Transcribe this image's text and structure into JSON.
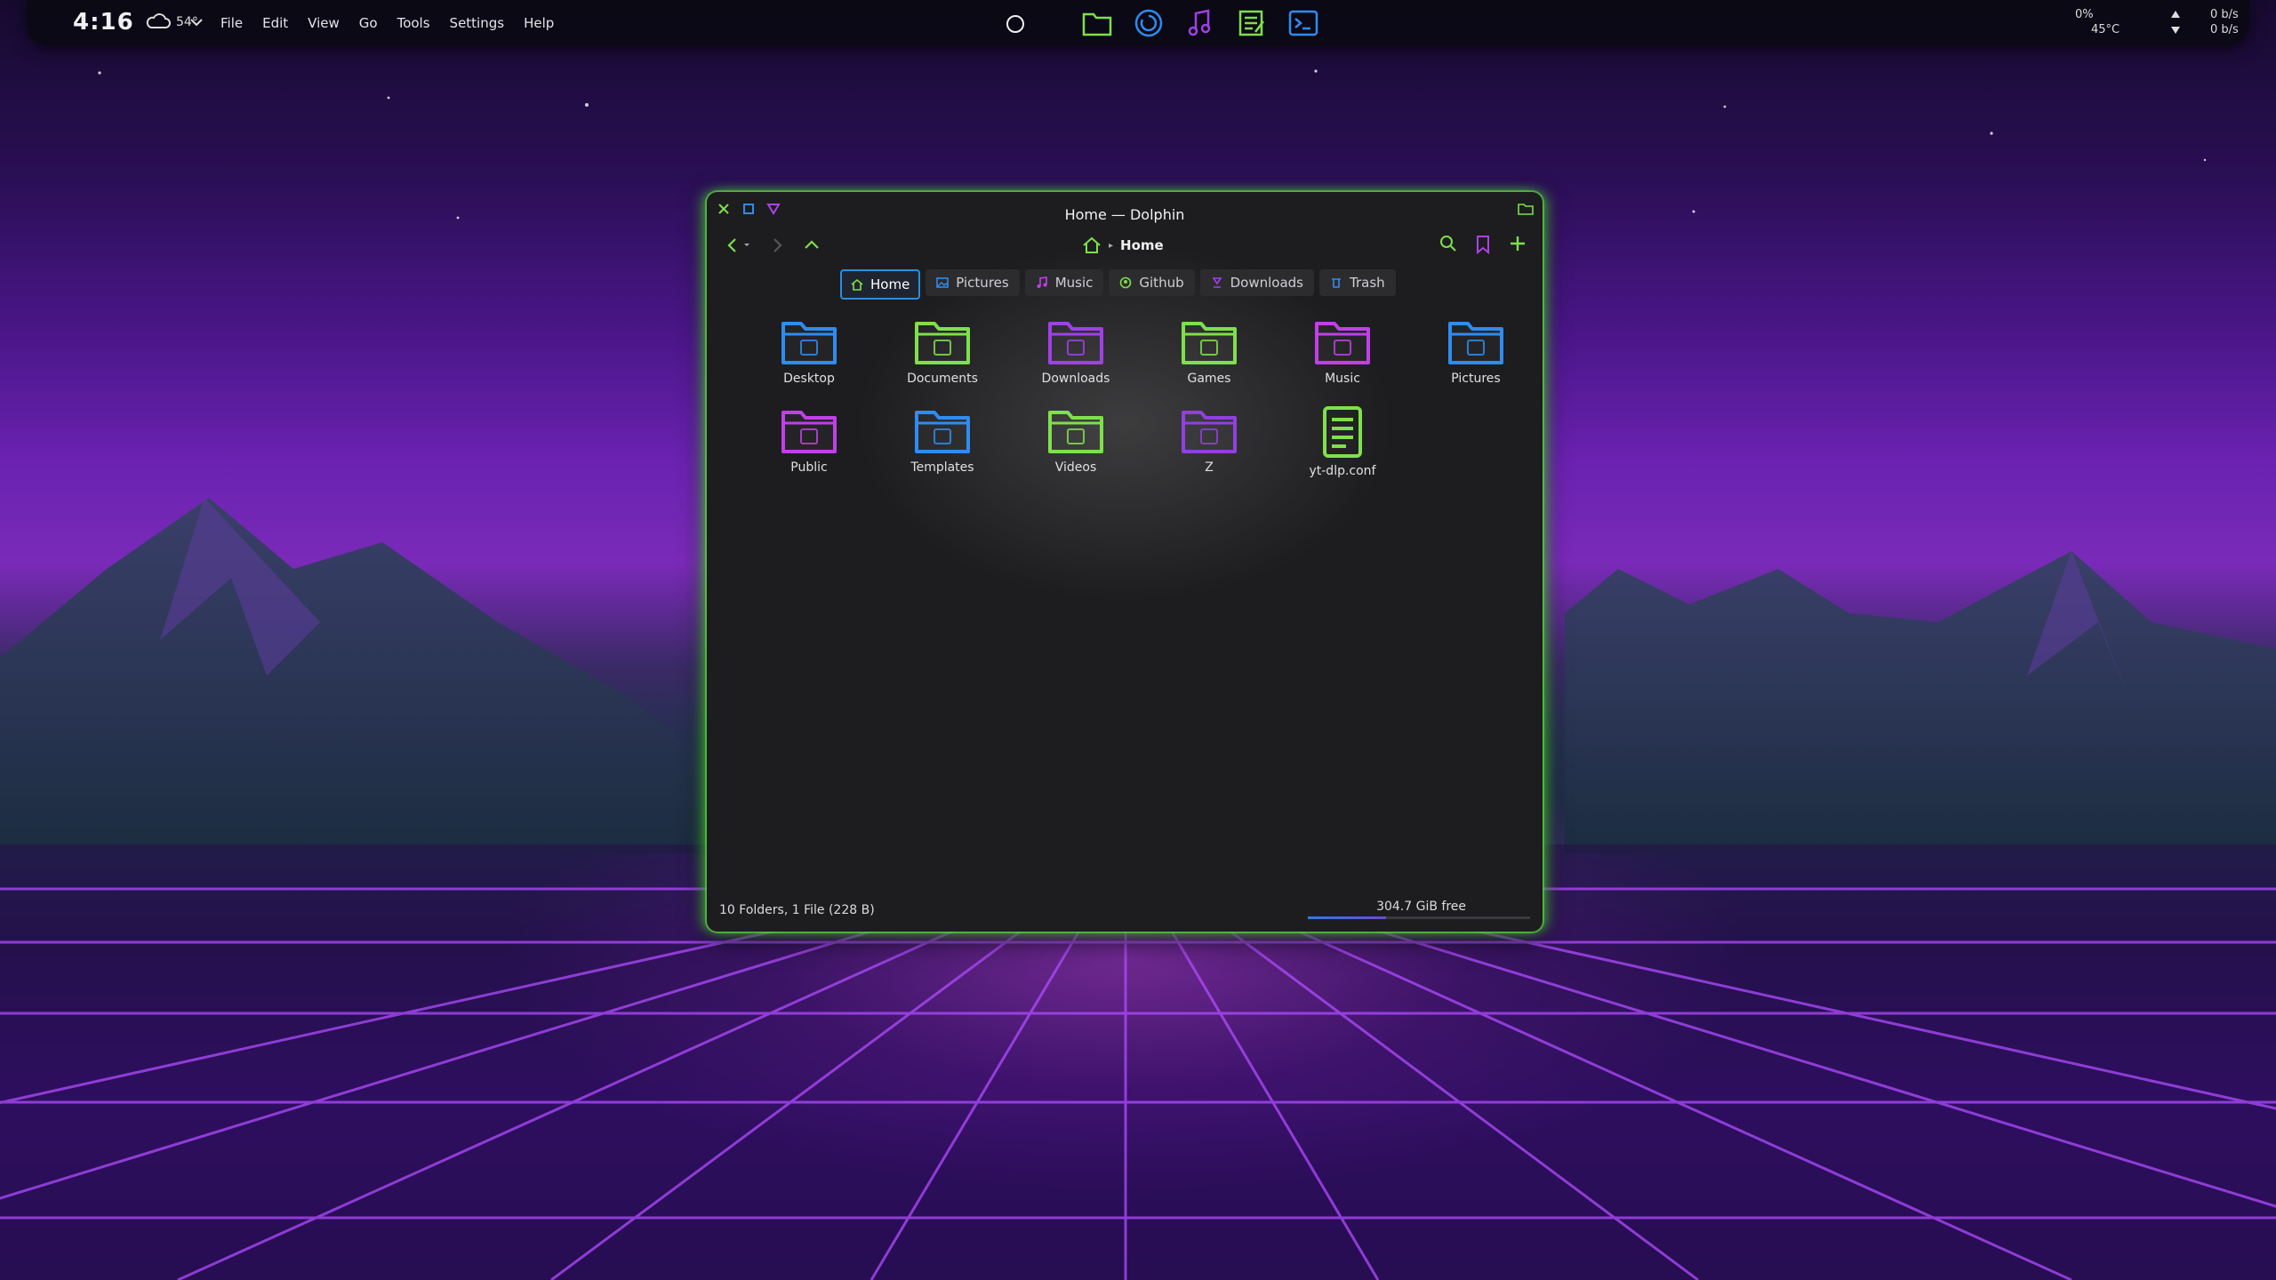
{
  "panel": {
    "clock": "4:16",
    "weather_temp": "54°",
    "menu": [
      "File",
      "Edit",
      "View",
      "Go",
      "Tools",
      "Settings",
      "Help"
    ],
    "apps": [
      "folder-icon",
      "refresh-icon",
      "music-icon",
      "notes-icon",
      "terminal-icon"
    ],
    "cpu": "0%",
    "temp": "45°C",
    "net_down": "0 b/s",
    "net_up": "0 b/s"
  },
  "window": {
    "title": "Home — Dolphin",
    "breadcrumb": "Home",
    "places": [
      {
        "label": "Home",
        "icon": "home-icon",
        "active": true
      },
      {
        "label": "Pictures",
        "icon": "image-icon"
      },
      {
        "label": "Music",
        "icon": "music-icon"
      },
      {
        "label": "Github",
        "icon": "github-icon"
      },
      {
        "label": "Downloads",
        "icon": "download-icon"
      },
      {
        "label": "Trash",
        "icon": "trash-icon"
      }
    ],
    "items": [
      {
        "label": "Desktop",
        "color": "#2f8cf0"
      },
      {
        "label": "Documents",
        "color": "#7ee04a"
      },
      {
        "label": "Downloads",
        "color": "#a040e8"
      },
      {
        "label": "Games",
        "color": "#7ee04a"
      },
      {
        "label": "Music",
        "color": "#c040e8"
      },
      {
        "label": "Pictures",
        "color": "#2f8cf0"
      },
      {
        "label": "Public",
        "color": "#c040e8"
      },
      {
        "label": "Templates",
        "color": "#2f8cf0"
      },
      {
        "label": "Videos",
        "color": "#7ee04a"
      },
      {
        "label": "Z",
        "color": "#9040e0"
      },
      {
        "label": "yt-dlp.conf",
        "color": "#7ee04a"
      }
    ],
    "status": "10 Folders, 1 File (228 B)",
    "free_space": "304.7 GiB free",
    "used_fraction": 0.35
  }
}
